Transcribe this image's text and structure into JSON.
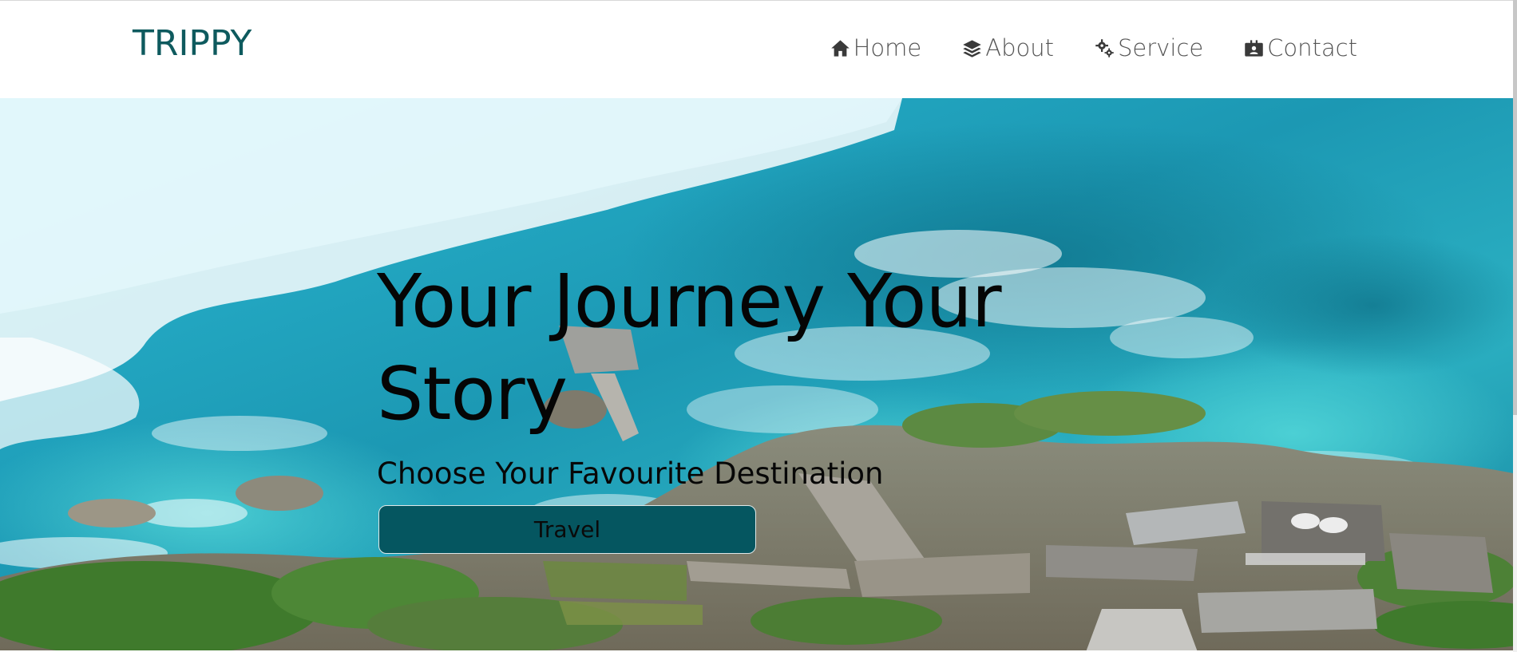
{
  "brand": {
    "name": "TRIPPY",
    "color": "#0e5a5e"
  },
  "nav": {
    "items": [
      {
        "label": "Home",
        "icon": "home-icon"
      },
      {
        "label": "About",
        "icon": "layers-icon"
      },
      {
        "label": "Service",
        "icon": "gears-icon"
      },
      {
        "label": "Contact",
        "icon": "contact-card-icon"
      }
    ]
  },
  "hero": {
    "title": "Your Journey Your Story",
    "subtitle": "Choose Your Favourite Destination",
    "button_label": "Travel",
    "button_color": "#055660",
    "background": "aerial ocean and cliff resort photo"
  }
}
